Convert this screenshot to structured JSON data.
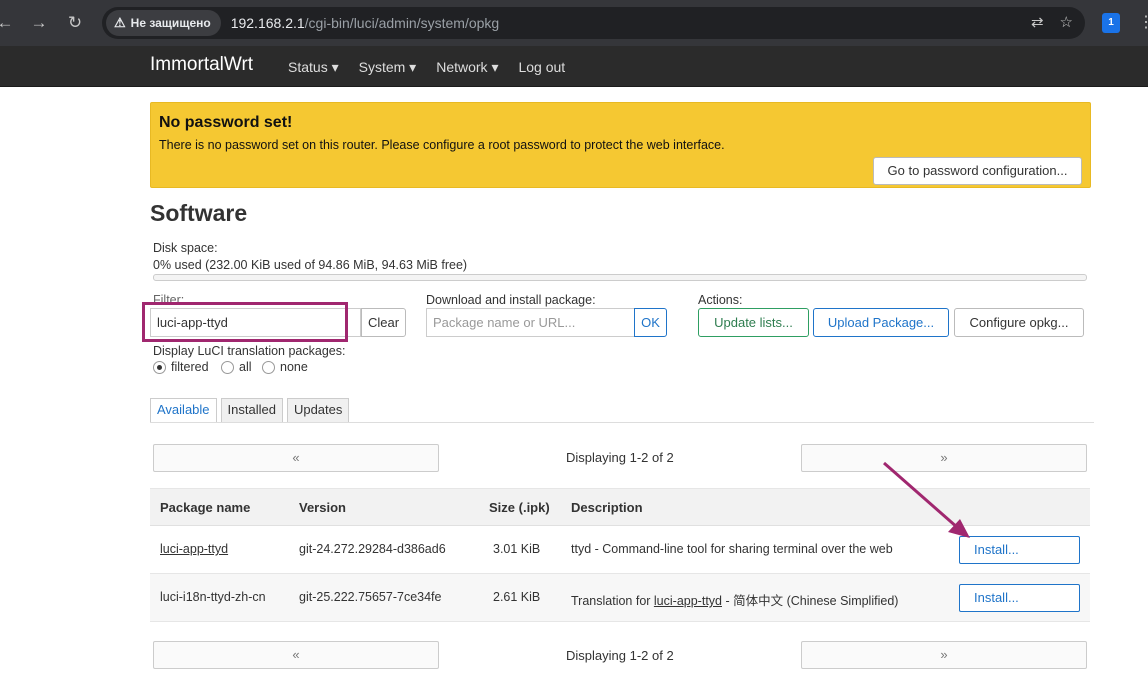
{
  "browser": {
    "security_label": "Не защищено",
    "url_host": "192.168.2.1",
    "url_path": "/cgi-bin/luci/admin/system/opkg",
    "extension_badge": "1"
  },
  "header": {
    "brand": "ImmortalWrt",
    "menu": [
      "Status ▾",
      "System ▾",
      "Network ▾",
      "Log out"
    ]
  },
  "alert": {
    "title": "No password set!",
    "text": "There is no password set on this router. Please configure a root password to protect the web interface.",
    "button": "Go to password configuration..."
  },
  "page": {
    "title": "Software",
    "disk_label": "Disk space:",
    "disk_value": "0% used (232.00 KiB used of 94.86 MiB, 94.63 MiB free)",
    "disk_used_fraction": 0
  },
  "filter": {
    "label": "Filter:",
    "value": "luci-app-ttyd",
    "clear": "Clear"
  },
  "download": {
    "label": "Download and install package:",
    "placeholder": "Package name or URL...",
    "ok": "OK"
  },
  "actions": {
    "label": "Actions:",
    "update": "Update lists...",
    "upload": "Upload Package...",
    "configure": "Configure opkg..."
  },
  "translation": {
    "label": "Display LuCI translation packages:",
    "options": [
      "filtered",
      "all",
      "none"
    ],
    "selected": "filtered"
  },
  "tabs": [
    "Available",
    "Installed",
    "Updates"
  ],
  "pager": {
    "prev": "«",
    "next": "»",
    "status": "Displaying 1-2 of 2"
  },
  "table": {
    "headers": [
      "Package name",
      "Version",
      "Size (.ipk)",
      "Description"
    ],
    "rows": [
      {
        "name": "luci-app-ttyd",
        "version": "git-24.272.29284-d386ad6",
        "size": "3.01 KiB",
        "desc_prefix": "ttyd - Command-line tool for sharing terminal over the web",
        "desc_link": "",
        "desc_suffix": "",
        "action": "Install..."
      },
      {
        "name": "luci-i18n-ttyd-zh-cn",
        "version": "git-25.222.75657-7ce34fe",
        "size": "2.61 KiB",
        "desc_prefix": "Translation for ",
        "desc_link": "luci-app-ttyd",
        "desc_suffix": " - 简体中文 (Chinese Simplified)",
        "action": "Install..."
      }
    ]
  },
  "annotation_color": "#a0276f"
}
